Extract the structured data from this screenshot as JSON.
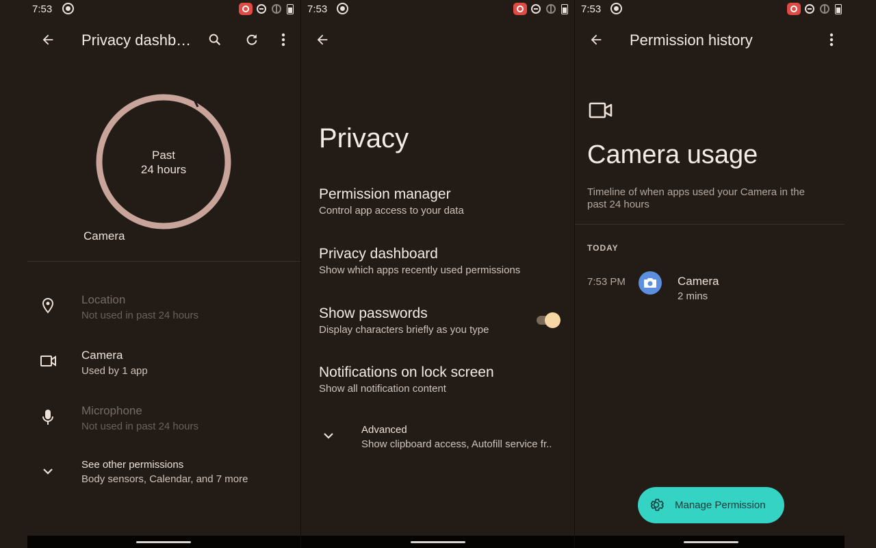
{
  "status_bar": {
    "time": "7:53"
  },
  "dashboard": {
    "title": "Privacy dashb…",
    "ring": {
      "line1": "Past",
      "line2": "24 hours",
      "legend": "Camera",
      "ring_color": "#c8a49a"
    },
    "permissions": [
      {
        "name": "Location",
        "sub": "Not used in past 24 hours",
        "icon": "location-pin-icon"
      },
      {
        "name": "Camera",
        "sub": "Used by 1 app",
        "icon": "videocam-icon"
      },
      {
        "name": "Microphone",
        "sub": "Not used in past 24 hours",
        "icon": "microphone-icon"
      }
    ],
    "other": {
      "title": "See other permissions",
      "sub": "Body sensors, Calendar, and 7 more",
      "icon": "chevron-down-icon"
    }
  },
  "privacy": {
    "title": "Privacy",
    "items": [
      {
        "title": "Permission manager",
        "sub": "Control app access to your data"
      },
      {
        "title": "Privacy dashboard",
        "sub": "Show which apps recently used permissions"
      },
      {
        "title": "Show passwords",
        "sub": "Display characters briefly as you type",
        "toggle_on": true
      },
      {
        "title": "Notifications on lock screen",
        "sub": "Show all notification content"
      }
    ],
    "advanced": {
      "title": "Advanced",
      "sub": "Show clipboard access, Autofill service fr..",
      "icon": "chevron-down-icon"
    }
  },
  "history": {
    "header": "Permission history",
    "icon": "videocam-icon",
    "title": "Camera usage",
    "description": "Timeline of when apps used your Camera in the past 24 hours",
    "section": "TODAY",
    "entries": [
      {
        "time": "7:53 PM",
        "app": "Camera",
        "duration": "2 mins",
        "icon": "camera-app-icon"
      }
    ],
    "fab": {
      "label": "Manage Permission",
      "icon": "gear-icon",
      "color": "#35d3c4"
    }
  }
}
